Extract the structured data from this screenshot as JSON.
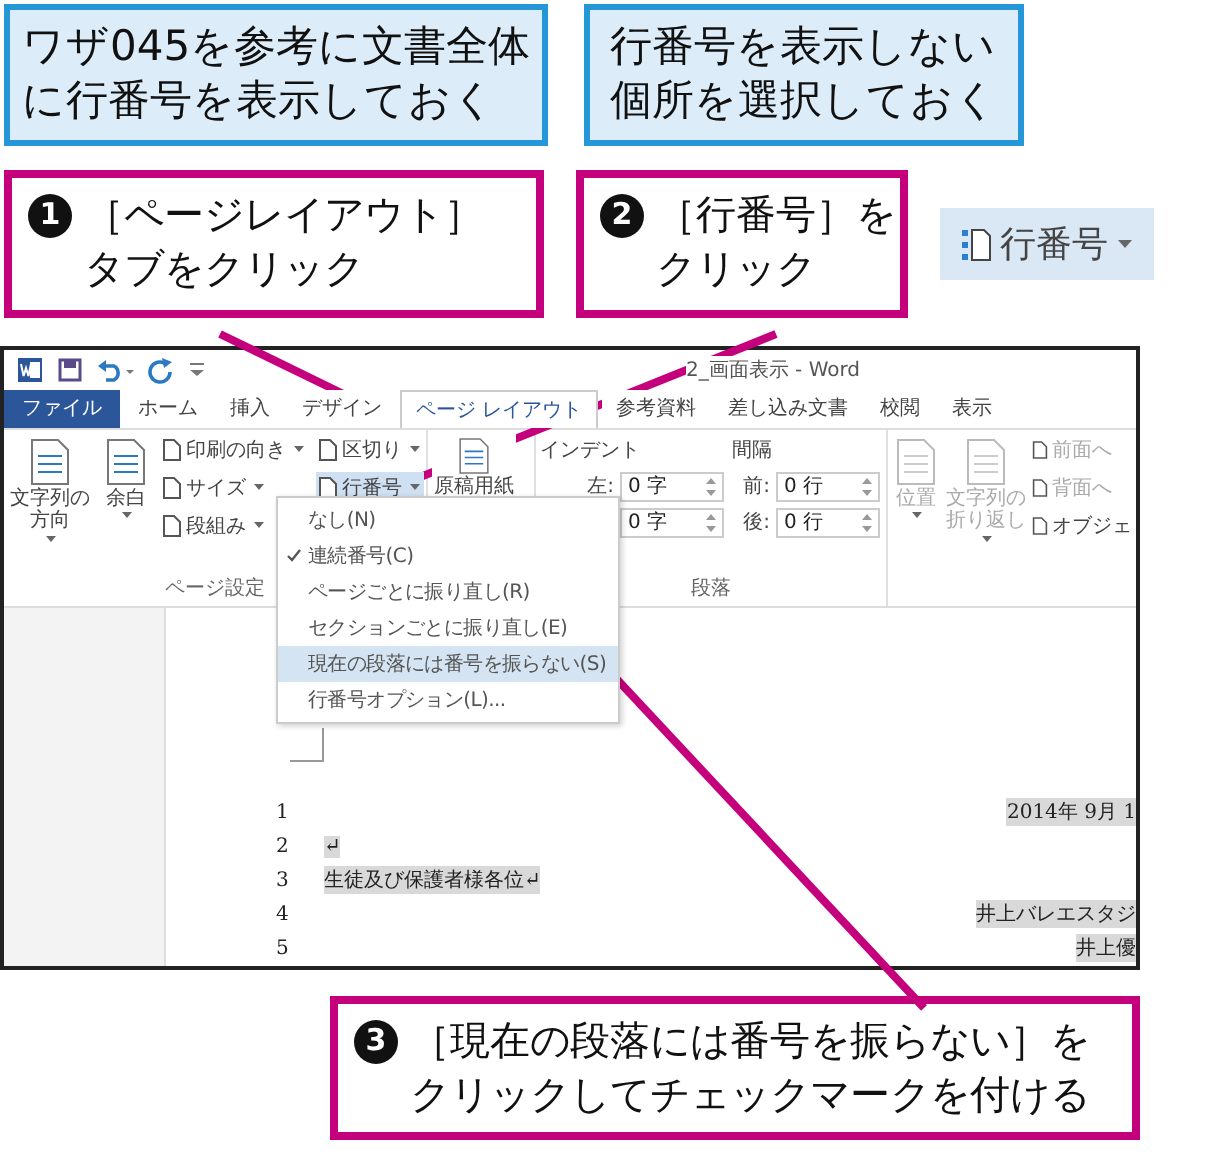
{
  "notes": [
    {
      "lines": [
        "ワザ045を参考に文書全体",
        "に行番号を表示しておく"
      ]
    },
    {
      "lines": [
        "行番号を表示しない",
        "個所を選択しておく"
      ]
    }
  ],
  "steps": [
    {
      "number": "1",
      "lines": [
        "［ページレイアウト］",
        "タブをクリック"
      ]
    },
    {
      "number": "2",
      "lines": [
        "［行番号］を",
        "クリック"
      ]
    }
  ],
  "button_preview": {
    "label": "行番号",
    "has_menu": true
  },
  "window": {
    "title": "2_画面表示 - Word",
    "quick_access": [
      {
        "kind": "word"
      },
      {
        "kind": "save"
      },
      {
        "kind": "undo"
      },
      {
        "kind": "redo"
      },
      {
        "kind": "customize"
      }
    ],
    "tabs": [
      {
        "label": "ファイル",
        "kind": "file",
        "selected": false
      },
      {
        "label": "ホーム",
        "kind": "tab",
        "selected": false
      },
      {
        "label": "挿入",
        "kind": "tab",
        "selected": false
      },
      {
        "label": "デザイン",
        "kind": "tab",
        "selected": false
      },
      {
        "label": "ページ レイアウト",
        "kind": "tab",
        "selected": true
      },
      {
        "label": "参考資料",
        "kind": "tab",
        "selected": false
      },
      {
        "label": "差し込み文書",
        "kind": "tab",
        "selected": false
      },
      {
        "label": "校閲",
        "kind": "tab",
        "selected": false
      },
      {
        "label": "表示",
        "kind": "tab",
        "selected": false
      }
    ],
    "ribbon": [
      {
        "label": "ページ設定",
        "columns": [
          [
            {
              "kind": "large",
              "lines": [
                "文字列の",
                "方向"
              ],
              "has_menu": true,
              "selected": false,
              "disabled": false
            }
          ],
          [
            {
              "kind": "large",
              "lines": [
                "余白"
              ],
              "has_menu": true,
              "selected": false,
              "disabled": false
            }
          ],
          [
            {
              "kind": "small",
              "label": "印刷の向き",
              "has_menu": true,
              "selected": false,
              "disabled": false
            },
            {
              "kind": "small",
              "label": "サイズ",
              "has_menu": true,
              "selected": false,
              "disabled": false
            },
            {
              "kind": "small",
              "label": "段組み",
              "has_menu": true,
              "selected": false,
              "disabled": false
            }
          ],
          [
            {
              "kind": "small",
              "label": "区切り",
              "has_menu": true,
              "selected": false,
              "disabled": false
            },
            {
              "kind": "small",
              "label": "行番号",
              "has_menu": true,
              "selected": true,
              "disabled": false
            }
          ]
        ]
      },
      {
        "columns": [
          [
            {
              "kind": "large",
              "lines": [
                "原稿用紙"
              ],
              "has_menu": false,
              "selected": false,
              "disabled": false
            }
          ]
        ]
      },
      {
        "label": "段落",
        "columns": [
          [
            {
              "kind": "heading",
              "label": "インデント"
            },
            {
              "kind": "spin",
              "label": "左:",
              "value": "0 字"
            },
            {
              "kind": "spin",
              "value": "0 字"
            }
          ],
          [
            {
              "kind": "heading",
              "label": "間隔"
            },
            {
              "kind": "spin",
              "label": "前:",
              "value": "0 行"
            },
            {
              "kind": "spin",
              "label": "後:",
              "value": "0 行"
            }
          ]
        ]
      },
      {
        "columns": [
          [
            {
              "kind": "large",
              "lines": [
                "位置"
              ],
              "has_menu": true,
              "selected": false,
              "disabled": true
            }
          ],
          [
            {
              "kind": "large",
              "lines": [
                "文字列の",
                "折り返し"
              ],
              "has_menu": true,
              "selected": false,
              "disabled": true
            }
          ],
          [
            {
              "kind": "small",
              "label": "前面へ",
              "has_menu": false,
              "selected": false,
              "disabled": true
            },
            {
              "kind": "small",
              "label": "背面へ",
              "has_menu": false,
              "selected": false,
              "disabled": true
            },
            {
              "kind": "small",
              "label": "オブジェ",
              "has_menu": false,
              "selected": false,
              "disabled": false
            }
          ]
        ]
      }
    ],
    "menu": [
      {
        "label": "なし(N)",
        "checked": false,
        "selected": false
      },
      {
        "label": "連続番号(C)",
        "checked": true,
        "selected": false
      },
      {
        "label": "ページごとに振り直し(R)",
        "checked": false,
        "selected": false
      },
      {
        "label": "セクションごとに振り直し(E)",
        "checked": false,
        "selected": false
      },
      {
        "label": "現在の段落には番号を振らない(S)",
        "checked": false,
        "selected": true
      },
      {
        "label": "行番号オプション(L)...",
        "checked": false,
        "selected": false
      }
    ],
    "document": [
      {
        "number": "1",
        "text": "2014年 9月 1",
        "kind": "right",
        "selected": true
      },
      {
        "number": "2",
        "text": "↵",
        "kind": "left",
        "selected": true
      },
      {
        "number": "3",
        "text": "生徒及び保護者様各位↵",
        "kind": "left",
        "selected": true
      },
      {
        "number": "4",
        "text": "井上バレエスタジ",
        "kind": "right",
        "selected": true
      },
      {
        "number": "5",
        "text": "井上優",
        "kind": "right",
        "selected": true
      }
    ]
  },
  "step3": {
    "number": "3",
    "lines": [
      "［現在の段落には番号を振らない］を",
      "クリックしてチェックマークを付ける"
    ]
  }
}
